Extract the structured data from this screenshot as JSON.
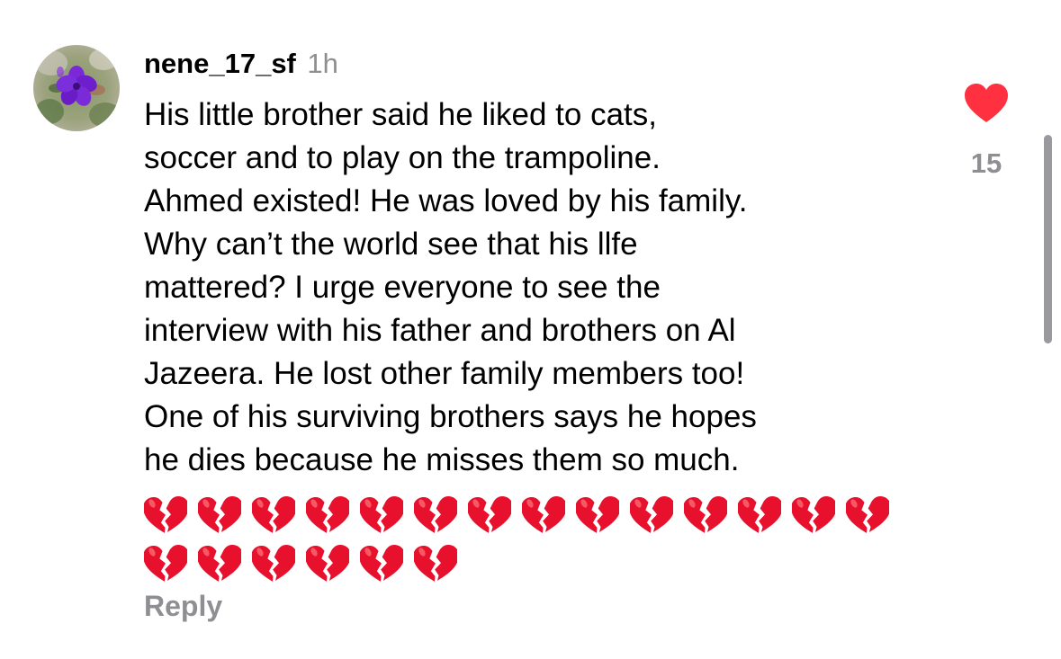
{
  "comment": {
    "username": "nene_17_sf",
    "timestamp": "1h",
    "text": "His little brother said he liked to cats,\nsoccer and to play on the trampoline.\nAhmed existed! He was loved by his family.\nWhy can’t the world see that his llfe\nmattered? I urge everyone to see the\ninterview with his father and brothers on Al\nJazeera. He lost other family members too!\nOne of his surviving brothers says he hopes\nhe dies because he misses  them so much.",
    "emoji": {
      "name": "broken-heart",
      "count": 20,
      "color": "#e8112d"
    },
    "reply_label": "Reply",
    "like": {
      "icon": "heart-icon",
      "liked": true,
      "color": "#ff3040",
      "count": "15"
    }
  },
  "avatar": {
    "icon": "purple-flower-avatar"
  },
  "colors": {
    "secondary_text": "#8e8e93",
    "scrollbar": "#9a9a9e"
  }
}
